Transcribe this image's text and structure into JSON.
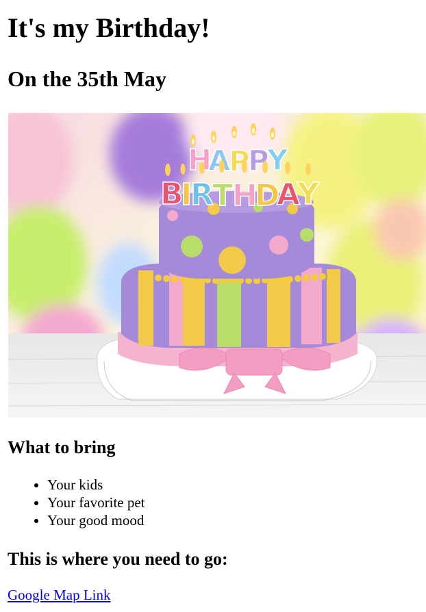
{
  "page": {
    "title": "It's my Birthday!",
    "subtitle": "On the 35th May"
  },
  "hero": {
    "cake_text_top": "HAPPY",
    "cake_text_bottom": "BIRTHDAY"
  },
  "bring": {
    "heading": "What to bring",
    "items": [
      "Your kids",
      "Your favorite pet",
      "Your good mood"
    ]
  },
  "directions": {
    "heading": "This is where you need to go:",
    "link_label": "Google Map Link"
  },
  "colors": {
    "link": "#0000ee",
    "cake_purple": "#a48ad8",
    "cake_yellow": "#f3c94a",
    "cake_green": "#b9dd6a",
    "cake_pink": "#f3a9cc"
  }
}
